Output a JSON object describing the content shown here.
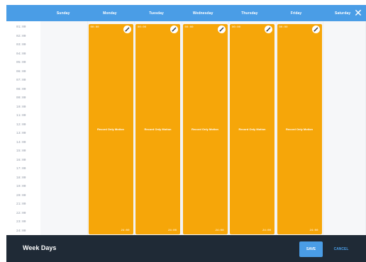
{
  "days": [
    "Sunday",
    "Monday",
    "Tuesday",
    "Wednesday",
    "Thursday",
    "Friday",
    "Saturday"
  ],
  "close_icon": "close-icon",
  "times": [
    "01:00",
    "02:00",
    "03:00",
    "04:00",
    "05:00",
    "06:00",
    "07:00",
    "08:00",
    "09:00",
    "10:00",
    "11:00",
    "12:00",
    "13:00",
    "14:00",
    "15:00",
    "16:00",
    "17:00",
    "18:00",
    "19:00",
    "20:00",
    "21:00",
    "22:00",
    "23:00",
    "24:00"
  ],
  "blocks": [
    {
      "day": "Monday",
      "start": "00:00",
      "end": "24:00",
      "label": "Record Only Motion"
    },
    {
      "day": "Tuesday",
      "start": "00:00",
      "end": "24:00",
      "label": "Record Only Motion"
    },
    {
      "day": "Wednesday",
      "start": "00:00",
      "end": "24:00",
      "label": "Record Only Motion"
    },
    {
      "day": "Thursday",
      "start": "00:00",
      "end": "24:00",
      "label": "Record Only Motion"
    },
    {
      "day": "Friday",
      "start": "00:00",
      "end": "24:00",
      "label": "Record Only Motion"
    }
  ],
  "footer": {
    "title": "Week Days",
    "save_label": "SAVE",
    "cancel_label": "CANCEL"
  },
  "colors": {
    "header": "#4a9de6",
    "block": "#f6a609",
    "footer": "#1f2a36"
  }
}
